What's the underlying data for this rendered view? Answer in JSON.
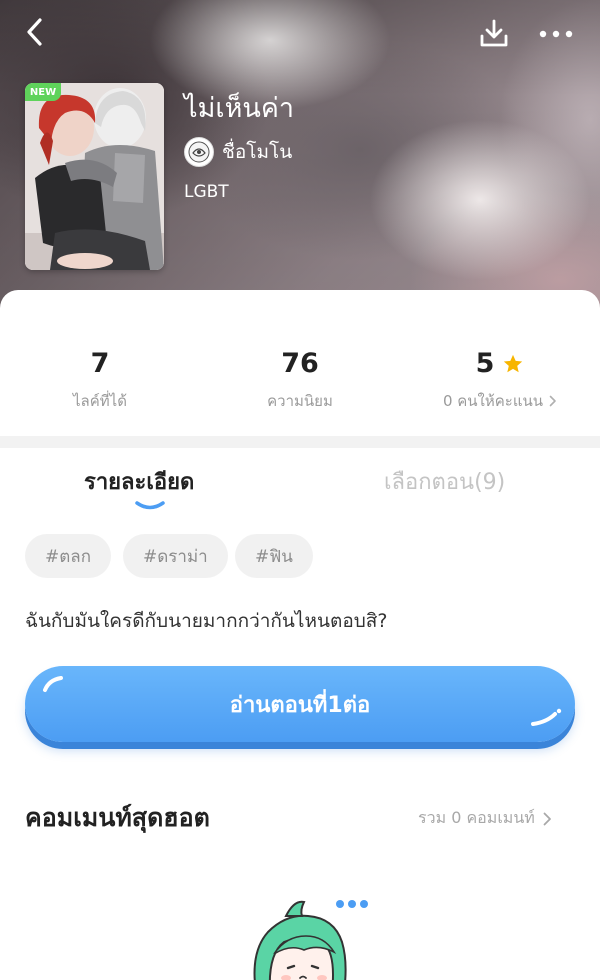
{
  "header": {
    "new_badge": "NEW",
    "title": "ไม่เห็นค่า",
    "author": "ชื่อโมโน",
    "genre": "LGBT"
  },
  "stats": [
    {
      "value": "7",
      "label": "ไลค์ที่ได้"
    },
    {
      "value": "76",
      "label": "ความนิยม"
    },
    {
      "value": "5",
      "label": "0 คนให้คะแนน"
    }
  ],
  "tabs": {
    "details": "รายละเอียด",
    "episodes": "เลือกตอน(9)"
  },
  "tags": [
    "#ตลก",
    "#ดราม่า",
    "#ฟิน"
  ],
  "synopsis": "ฉันกับมันใครดีกับนายมากกว่ากันไหนตอบสิ?",
  "read_button": "อ่านตอนที่1ต่อ",
  "hot_comments": {
    "title": "คอมเมนท์สุดฮอต",
    "count_label": "รวม 0 คอมเมนท์"
  },
  "colors": {
    "accent_blue": "#4c9df3",
    "star": "#f7b500",
    "new_badge": "#5fd35b",
    "mascot_hair": "#5ad4a5"
  },
  "icons": [
    "back-icon",
    "download-icon",
    "more-icon",
    "star-icon",
    "chevron-right-icon"
  ]
}
